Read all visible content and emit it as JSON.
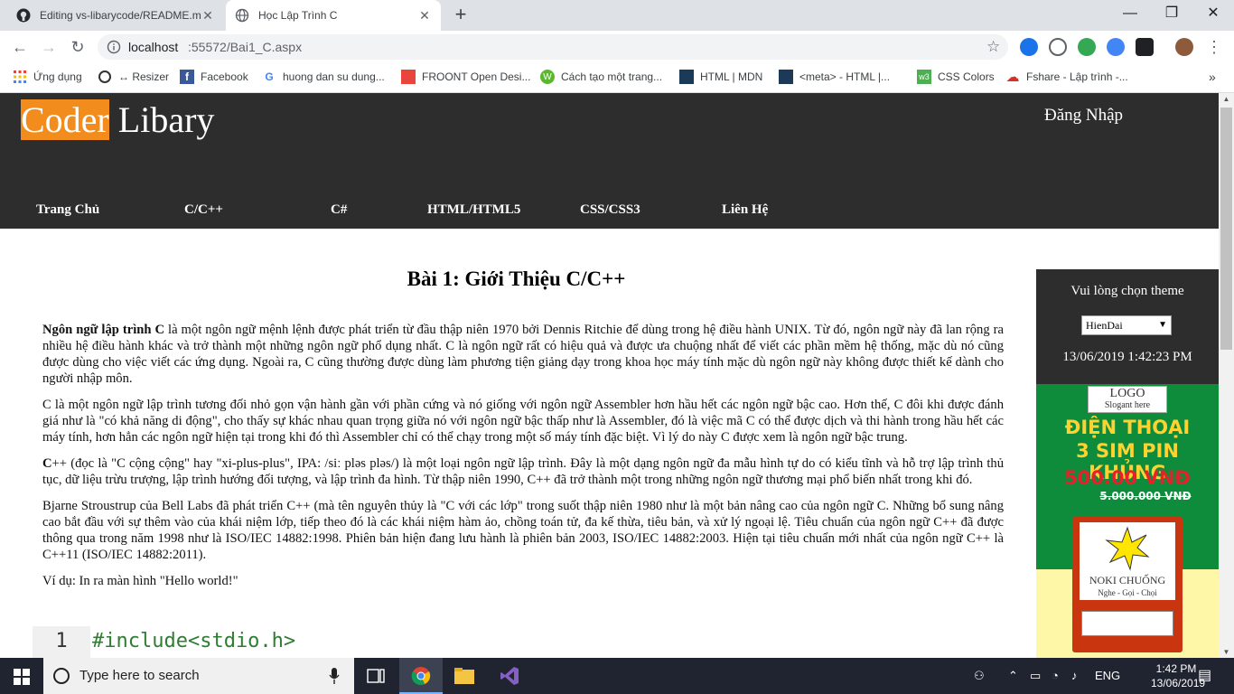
{
  "browser": {
    "tabs": [
      {
        "title": "Editing vs-libarycode/README.m",
        "close": "✕",
        "icon": "github-icon"
      },
      {
        "title": "Học Lập Trình C",
        "close": "✕",
        "icon": "globe-icon"
      }
    ],
    "new_tab": "+",
    "window_controls": {
      "minimize": "—",
      "maximize": "❐",
      "close": "✕"
    },
    "url_host": "localhost",
    "url_rest": ":55572/Bai1_C.aspx",
    "bookmarks": [
      {
        "label": "Ứng dụng",
        "icon": "apps-grid-icon"
      },
      {
        "label": "↔ Resizer",
        "icon": "resizer-icon"
      },
      {
        "label": "Facebook",
        "icon": "facebook-icon"
      },
      {
        "label": "huong dan su dung...",
        "icon": "google-icon"
      },
      {
        "label": "FROONT Open Desi...",
        "icon": "froont-icon"
      },
      {
        "label": "Cách tạo một trang...",
        "icon": "wordpress-icon"
      },
      {
        "label": "HTML | MDN",
        "icon": "mdn-icon"
      },
      {
        "label": "<meta> - HTML |...",
        "icon": "mdn-icon"
      },
      {
        "label": "CSS Colors",
        "icon": "w3schools-icon"
      },
      {
        "label": "Fshare - Lập trình -...",
        "icon": "fshare-icon"
      }
    ],
    "more_bookmarks": "»"
  },
  "site": {
    "logo_highlight": "Coder",
    "logo_rest": " Libary",
    "login": "Đăng Nhập",
    "nav": [
      "Trang Chủ",
      "C/C++",
      "C#",
      "HTML/HTML5",
      "CSS/CSS3",
      "Liên Hệ"
    ]
  },
  "article": {
    "title": "Bài 1: Giới Thiệu C/C++",
    "p1_bold": "Ngôn ngữ lập trình C",
    "p1": " là một ngôn ngữ mệnh lệnh được phát triển từ đầu thập niên 1970 bởi Dennis Ritchie để dùng trong hệ điều hành UNIX. Từ đó, ngôn ngữ này đã lan rộng ra nhiều hệ điều hành khác và trở thành một những ngôn ngữ phổ dụng nhất. C là ngôn ngữ rất có hiệu quả và được ưa chuộng nhất để viết các phần mềm hệ thống, mặc dù nó cũng được dùng cho việc viết các ứng dụng. Ngoài ra, C cũng thường được dùng làm phương tiện giảng dạy trong khoa học máy tính mặc dù ngôn ngữ này không được thiết kế dành cho người nhập môn.",
    "p2": "C là một ngôn ngữ lập trình tương đối nhỏ gọn vận hành gần với phần cứng và nó giống với ngôn ngữ Assembler hơn hầu hết các ngôn ngữ bậc cao. Hơn thế, C đôi khi được đánh giá như là \"có khả năng di động\", cho thấy sự khác nhau quan trọng giữa nó với ngôn ngữ bậc thấp như là Assembler, đó là việc mã C có thể được dịch và thi hành trong hầu hết các máy tính, hơn hẳn các ngôn ngữ hiện tại trong khi đó thì Assembler chỉ có thể chạy trong một số máy tính đặc biệt. Vì lý do này C được xem là ngôn ngữ bậc trung.",
    "p3_bold": "C",
    "p3": "++ (đọc là \"C cộng cộng\" hay \"xi-plus-plus\", IPA: /siː pləs pləs/) là một loại ngôn ngữ lập trình. Đây là một dạng ngôn ngữ đa mẫu hình tự do có kiểu tĩnh và hỗ trợ lập trình thủ tục, dữ liệu trừu trượng, lập trình hướng đối tượng, và lập trình đa hình. Từ thập niên 1990, C++ đã trở thành một trong những ngôn ngữ thương mại phổ biến nhất trong khi đó.",
    "p4": "Bjarne Stroustrup của Bell Labs đã phát triển C++ (mà tên nguyên thủy là \"C với các lớp\" trong suốt thập niên 1980 như là một bản nâng cao của ngôn ngữ C. Những bổ sung nâng cao bắt đầu với sự thêm vào của khái niệm lớp, tiếp theo đó là các khái niệm hàm ảo, chồng toán tử, đa kế thừa, tiêu bản, và xử lý ngoại lệ. Tiêu chuẩn của ngôn ngữ C++ đã được thông qua trong năm 1998 như là ISO/IEC 14882:1998. Phiên bản hiện đang lưu hành là phiên bản 2003, ISO/IEC 14882:2003. Hiện tại tiêu chuẩn mới nhất của ngôn ngữ C++ là C++11 (ISO/IEC 14882:2011).",
    "p5": "Ví dụ: In ra màn hình \"Hello world!\"",
    "code_line_number": "1",
    "code_line": "#include<stdio.h>"
  },
  "sidebar": {
    "theme_label": "Vui lòng chọn theme",
    "theme_selected": "HienDai",
    "datetime": "13/06/2019 1:42:23 PM",
    "ad": {
      "logo": "LOGO",
      "slogan": "Slogant here",
      "headline1": "ĐIỆN THOẠI",
      "headline2": "3 SIM PIN KHỦNG",
      "price": "500.00 VNĐ",
      "old_price": "5.000.000 VNĐ",
      "brand": "NOKI CHUỐNG",
      "sub": "Nghe - Gọi - Chọi"
    }
  },
  "taskbar": {
    "search_placeholder": "Type here to search",
    "lang": "ENG",
    "time": "1:42 PM",
    "date": "13/06/2019"
  },
  "colors": {
    "header_bg": "#2d2d2d",
    "logo_accent": "#f28c1c",
    "ad_green": "#0e8c3c"
  }
}
